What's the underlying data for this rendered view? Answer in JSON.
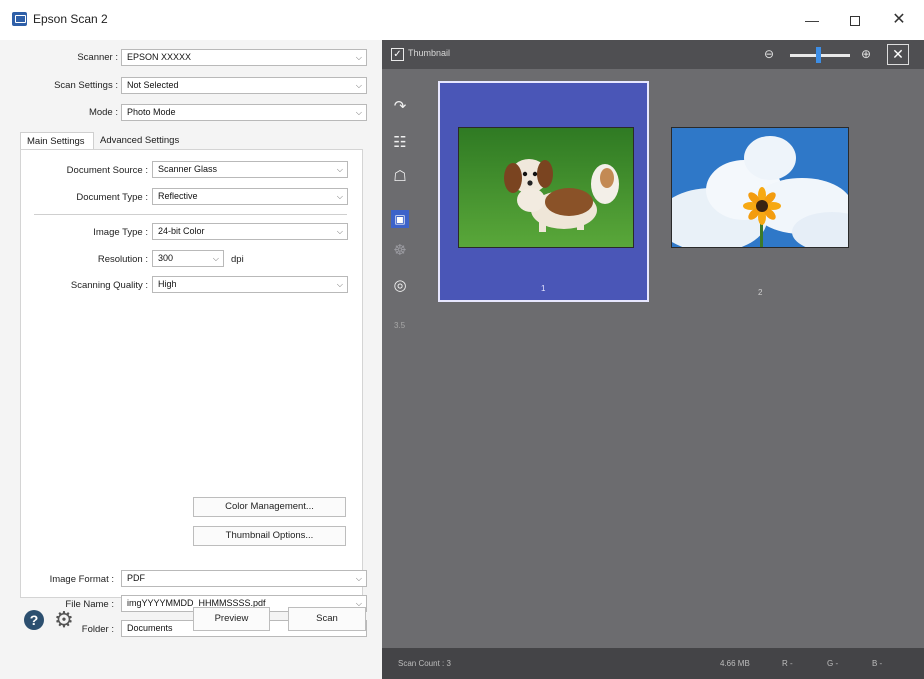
{
  "window": {
    "title": "Epson Scan 2",
    "controls": {
      "minimize": "—",
      "close": "✕"
    }
  },
  "scanner": {
    "label": "Scanner :",
    "value": "EPSON XXXXX"
  },
  "scan_settings": {
    "label": "Scan Settings :",
    "value": "Not Selected"
  },
  "mode": {
    "label": "Mode :",
    "value": "Photo Mode"
  },
  "tabs": [
    {
      "label": "Main Settings",
      "active": true
    },
    {
      "label": "Advanced Settings",
      "active": false
    }
  ],
  "main_settings": {
    "document_source": {
      "label": "Document Source :",
      "value": "Scanner Glass"
    },
    "document_type": {
      "label": "Document Type :",
      "value": "Reflective"
    },
    "image_type": {
      "label": "Image Type :",
      "value": "24-bit Color"
    },
    "resolution": {
      "label": "Resolution :",
      "value": "300",
      "unit": "dpi"
    },
    "scanning_quality": {
      "label": "Scanning Quality :",
      "value": "High"
    },
    "color_management_label": "Color Management...",
    "thumbnail_options_label": "Thumbnail Options..."
  },
  "output": {
    "image_format": {
      "label": "Image Format :",
      "value": "PDF"
    },
    "file_name": {
      "label": "File Name :",
      "value": "imgYYYYMMDD_HHMMSSSS.pdf"
    },
    "folder": {
      "label": "Folder :",
      "value": "Documents"
    }
  },
  "actions": {
    "preview_label": "Preview",
    "scan_label": "Scan"
  },
  "icons": {
    "help": "?",
    "settings": "⚙",
    "chevron": "⌵",
    "check": "✓",
    "zoom_out": "⊖",
    "zoom_in": "⊕",
    "close_thumbnail": "✕",
    "rotate": "↷",
    "tool_2": "☷",
    "tool_3": "☖",
    "auto_adjust": "▣",
    "tool_5": "☸",
    "tool_6": "◎"
  },
  "preview_panel": {
    "thumbnail_toggle_label": "Thumbnail",
    "thumbnail_checked": true,
    "zoom_level": 0.45,
    "tool_value": "3.5",
    "thumbnails": [
      {
        "number": "1",
        "selected": true
      },
      {
        "number": "2",
        "selected": false
      }
    ],
    "status": {
      "scan_count": "Scan Count : 3",
      "size": "4.66 MB",
      "r": "R  -",
      "g": "G  -",
      "b": "B  -"
    }
  },
  "colors": {
    "accent_selected": "#4a56b7",
    "preview_background": "#6c6c6f",
    "zoom_slider": "#3d8ee6"
  }
}
